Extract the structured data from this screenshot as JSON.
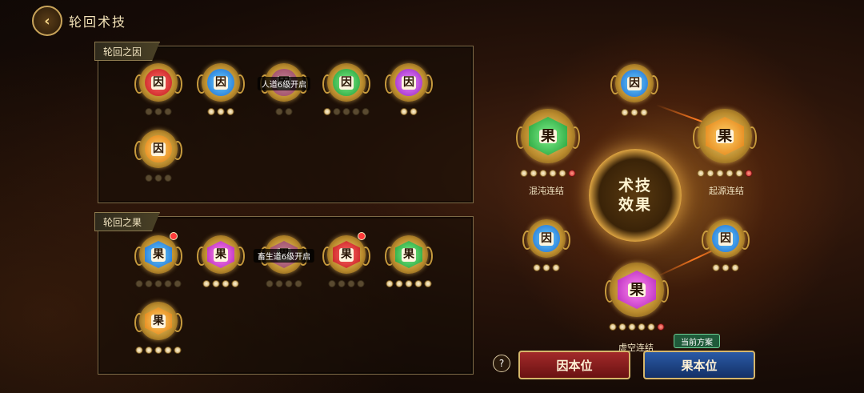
{
  "header": {
    "title": "轮回术技",
    "back_icon": "chevron-left-icon"
  },
  "cause_panel": {
    "label": "轮回之因",
    "items": [
      {
        "glyph": "因",
        "color": "#c01818",
        "locked_text": "",
        "pips": 3
      },
      {
        "glyph": "因",
        "color": "#1c6ad0",
        "locked_text": "",
        "pips": 3
      },
      {
        "glyph": "因",
        "color": "#d05a80",
        "locked_text": "人道6级开启",
        "pips": 2
      },
      {
        "glyph": "因",
        "color": "#1e9a34",
        "locked_text": "",
        "pips": 5
      },
      {
        "glyph": "因",
        "color": "#9424c0",
        "locked_text": "",
        "pips": 2
      },
      {
        "glyph": "因",
        "color": "#e0780c",
        "locked_text": "",
        "pips": 3
      }
    ]
  },
  "effect_panel": {
    "label": "轮回之果",
    "items": [
      {
        "glyph": "果",
        "color": "#1c6ad0",
        "locked_text": "",
        "pips": 5,
        "badge": true
      },
      {
        "glyph": "果",
        "color": "#b020b8",
        "locked_text": "",
        "pips": 4,
        "badge": false
      },
      {
        "glyph": "果",
        "color": "#d05a80",
        "locked_text": "畜生道6级开启",
        "pips": 4,
        "badge": false
      },
      {
        "glyph": "果",
        "color": "#c01818",
        "locked_text": "",
        "pips": 4,
        "badge": true
      },
      {
        "glyph": "果",
        "color": "#1e9a34",
        "locked_text": "",
        "pips": 5,
        "badge": false
      },
      {
        "glyph": "果",
        "color": "#e0780c",
        "locked_text": "",
        "pips": 5,
        "badge": false
      }
    ]
  },
  "wheel": {
    "center_text": "术技效果",
    "nodes": {
      "top": {
        "glyph": "因",
        "color": "#1c6ad0"
      },
      "left_big": {
        "glyph": "果",
        "color": "#1e9a34",
        "label": "混沌连结"
      },
      "right_big": {
        "glyph": "果",
        "color": "#e0780c",
        "label": "起源连结"
      },
      "left_small": {
        "glyph": "因",
        "color": "#1c6ad0"
      },
      "right_small": {
        "glyph": "因",
        "color": "#1c6ad0"
      },
      "bottom_big": {
        "glyph": "果",
        "color": "#b020b8",
        "label": "虚空连结"
      }
    }
  },
  "footer": {
    "help_label": "?",
    "cause_button": "因本位",
    "effect_button": "果本位",
    "current_plan_tag": "当前方案"
  }
}
